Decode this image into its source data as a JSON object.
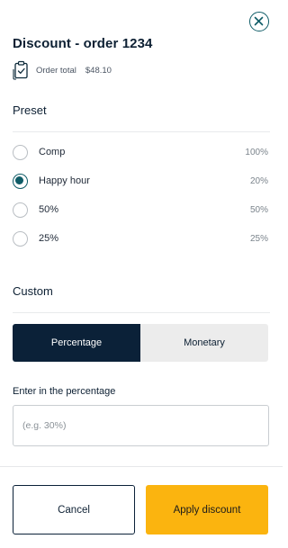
{
  "header": {
    "title": "Discount - order 1234",
    "order_total_label": "Order total",
    "order_total_value": "$48.10"
  },
  "icons": {
    "close": "close-circle-icon",
    "receipt": "receipt-icon"
  },
  "preset": {
    "title": "Preset",
    "options": [
      {
        "name": "Comp",
        "value": "100%",
        "selected": false
      },
      {
        "name": "Happy hour",
        "value": "20%",
        "selected": true
      },
      {
        "name": "50%",
        "value": "50%",
        "selected": false
      },
      {
        "name": "25%",
        "value": "25%",
        "selected": false
      }
    ]
  },
  "custom": {
    "title": "Custom",
    "tabs": [
      {
        "label": "Percentage",
        "active": true
      },
      {
        "label": "Monetary",
        "active": false
      }
    ],
    "input_label": "Enter in the percentage",
    "input_placeholder": "(e.g. 30%)",
    "input_value": ""
  },
  "actions": {
    "cancel_label": "Cancel",
    "apply_label": "Apply discount"
  },
  "colors": {
    "primary_dark": "#0b2138",
    "teal": "#0f5c67",
    "accent_yellow": "#fbb40f",
    "segment_inactive": "#ececec"
  }
}
